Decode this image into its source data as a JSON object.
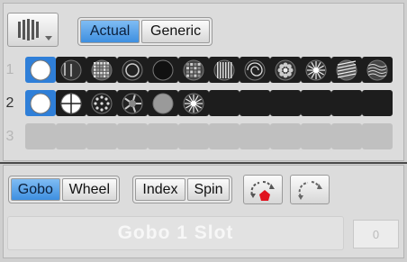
{
  "top_toggles": {
    "actual": "Actual",
    "generic": "Generic",
    "active": "actual"
  },
  "rows": [
    {
      "label": "1",
      "dimmed": true,
      "cells": [
        "white",
        "speckle",
        "mosaic",
        "ring",
        "dark",
        "cells",
        "bars",
        "swirl",
        "flower",
        "spiral",
        "stripes",
        "waves"
      ]
    },
    {
      "label": "2",
      "dimmed": false,
      "cells": [
        "white",
        "cross",
        "dots",
        "fan",
        "grey",
        "spiral",
        "black",
        "black",
        "black",
        "black",
        "black",
        "black"
      ]
    },
    {
      "label": "3",
      "dimmed": true,
      "cells": [
        "empty",
        "empty",
        "empty",
        "empty",
        "empty",
        "empty",
        "empty",
        "empty",
        "empty",
        "empty",
        "empty",
        "empty"
      ]
    }
  ],
  "mode_toggle": {
    "gobo": "Gobo",
    "wheel": "Wheel",
    "active": "gobo"
  },
  "index_spin": {
    "index": "Index",
    "spin": "Spin"
  },
  "slider": {
    "label": "Gobo 1 Slot"
  },
  "value_box": {
    "value": "0"
  },
  "colors": {
    "accent": "#3e8fe0",
    "red": "#e0121e"
  }
}
